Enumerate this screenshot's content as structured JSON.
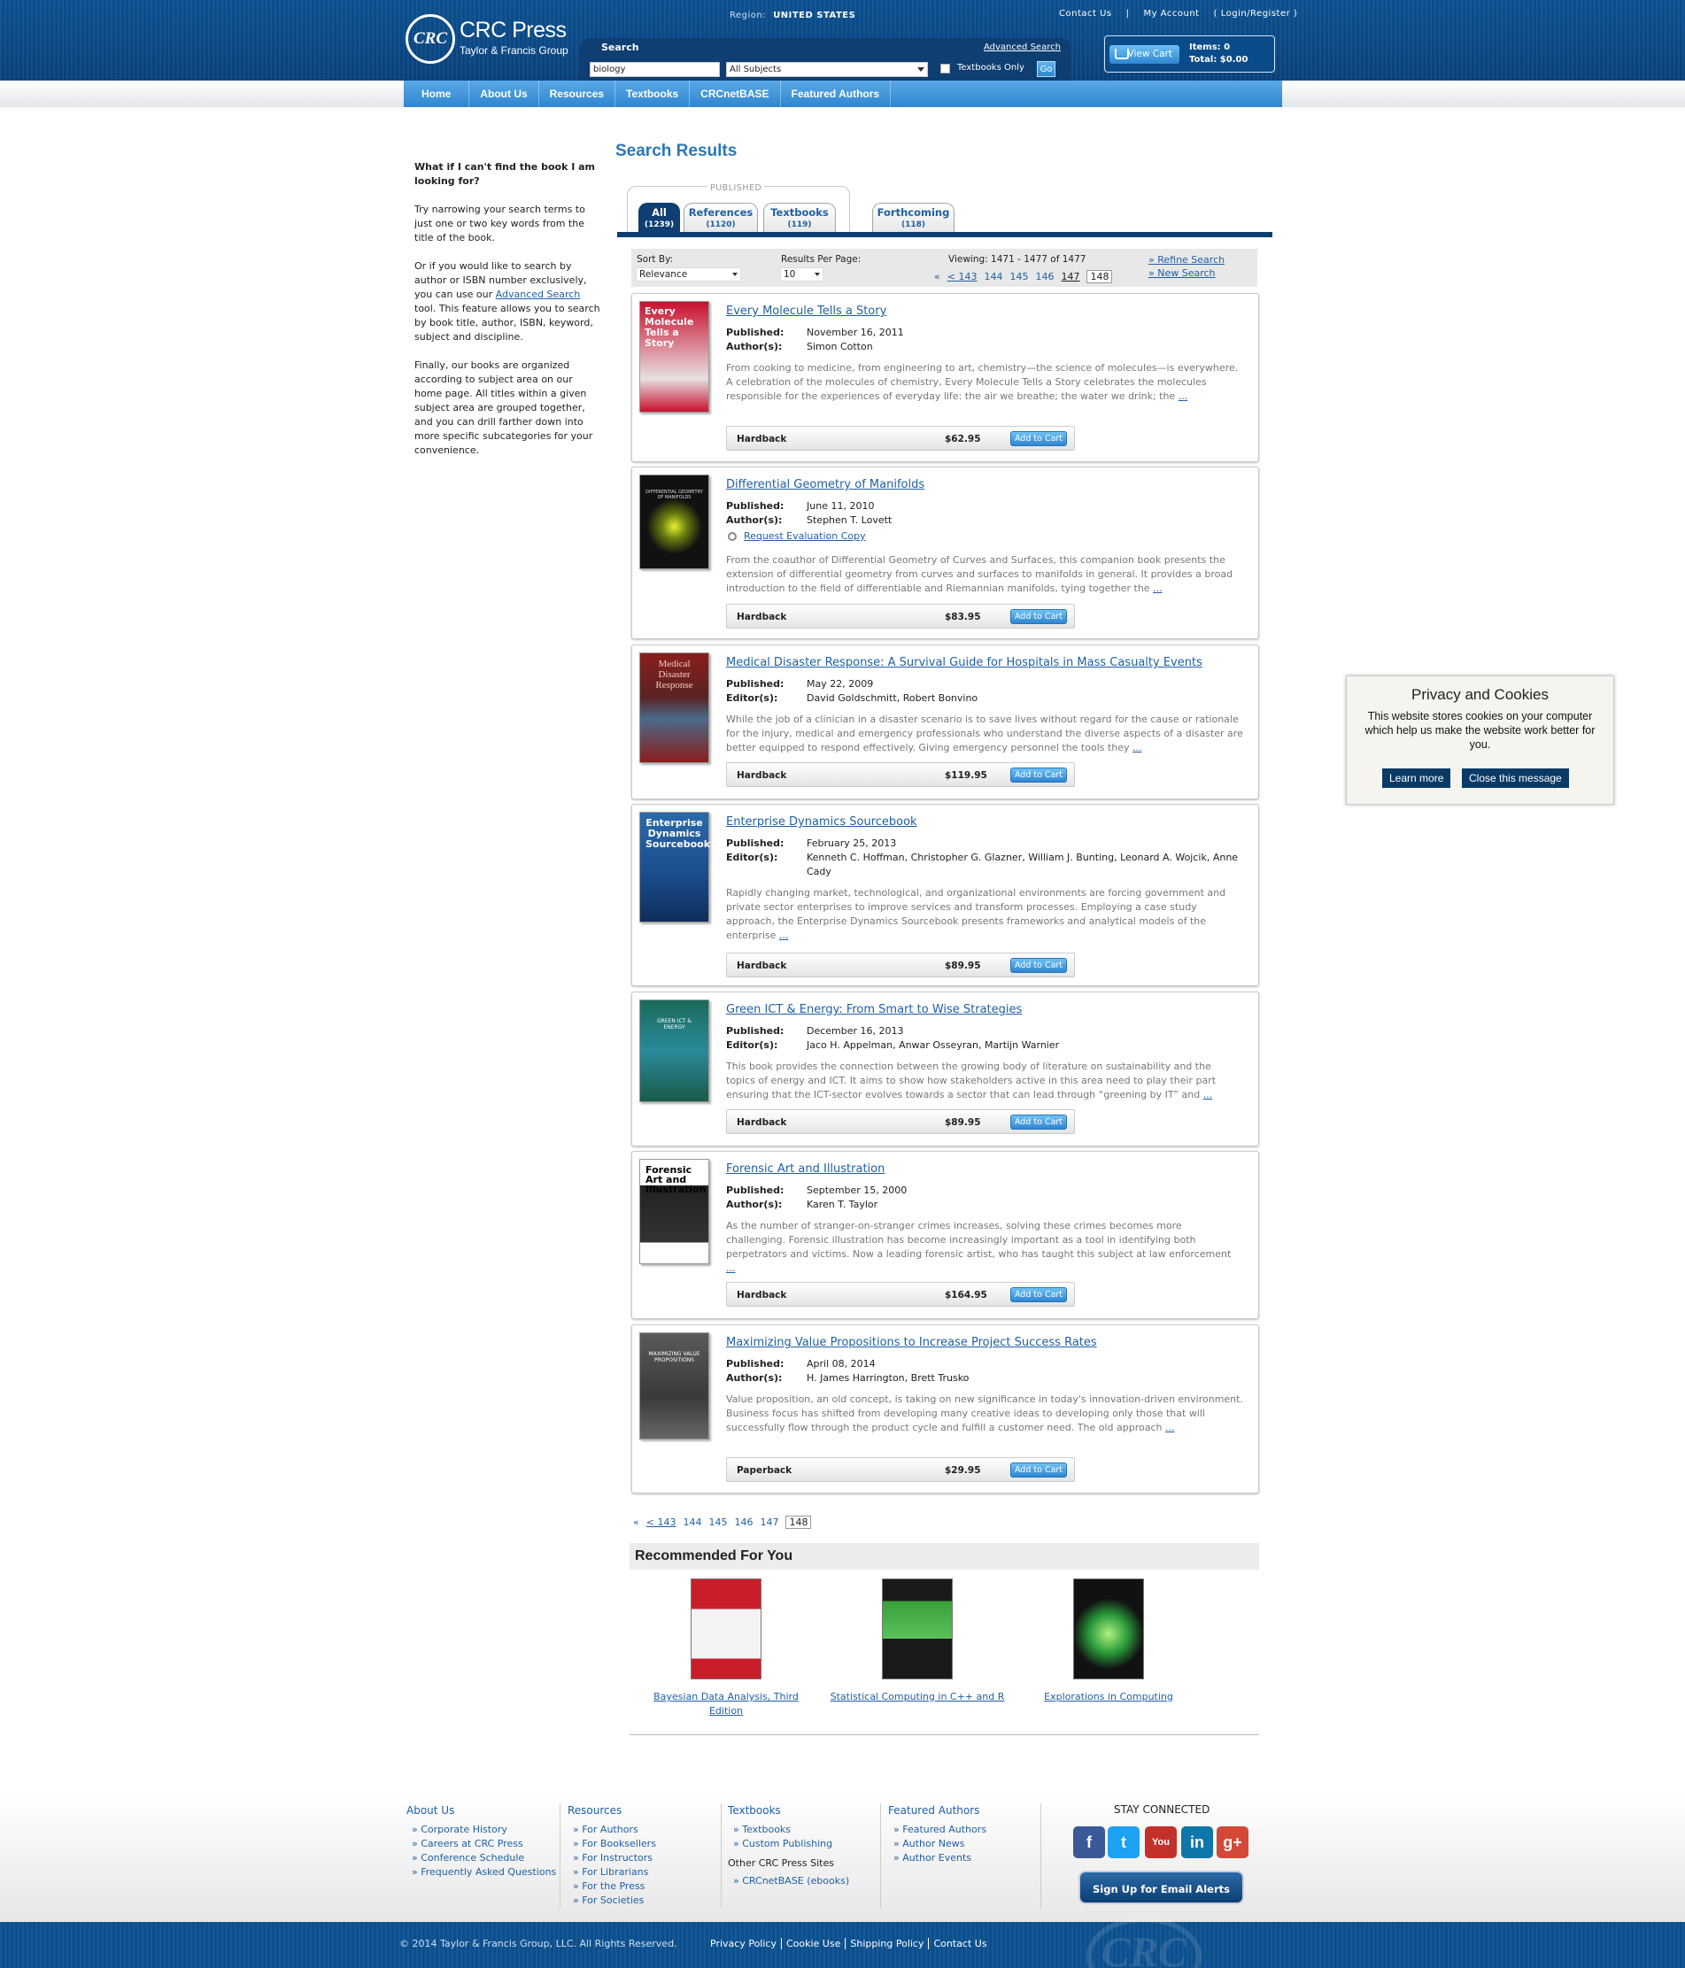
{
  "header": {
    "brand": "CRC Press",
    "brand_sub": "Taylor & Francis Group",
    "logo_text": "CRC",
    "region_label": "Region:",
    "region_value": "UNITED STATES",
    "top_links": [
      "Contact Us",
      "My Account",
      "( Login/Register )"
    ],
    "search_label": "Search",
    "advanced_search": "Advanced Search",
    "search_value": "biology",
    "subject_value": "All Subjects",
    "textbooks_only": "Textbooks Only",
    "go": "Go",
    "view_cart": "View Cart",
    "items": "Items: 0",
    "total": "Total: $0.00"
  },
  "nav": [
    "Home",
    "About Us",
    "Resources",
    "Textbooks",
    "CRCnetBASE",
    "Featured Authors"
  ],
  "help": {
    "heading": "What if I can't find the book I am looking for?",
    "p1": "Try narrowing your search terms to just one or two key words from the title of the book.",
    "p2a": "Or if you would like to search by author or ISBN number exclusively, you can use our ",
    "p2link": "Advanced Search",
    "p2b": " tool. This feature allows you to search by book title, author, ISBN, keyword, subject and discipline.",
    "p3": "Finally, our books are organized according to subject area on our home page. All titles within a given subject area are grouped together, and you can drill farther down into more specific subcategories for your convenience."
  },
  "results": {
    "title": "Search Results",
    "published_label": "PUBLISHED",
    "tabs": [
      {
        "label": "All",
        "count": "(1239)"
      },
      {
        "label": "References",
        "count": "(1120)"
      },
      {
        "label": "Textbooks",
        "count": "(119)"
      },
      {
        "label": "Forthcoming",
        "count": "(118)"
      }
    ],
    "sort_label": "Sort By:",
    "sort_value": "Relevance",
    "rpp_label": "Results Per Page:",
    "rpp_value": "10",
    "viewing": "Viewing: 1471 - 1477 of 1477",
    "pager": {
      "prev": "«",
      "first": "< 143",
      "pages": [
        "144",
        "145",
        "146"
      ],
      "p147": "147",
      "current": "148"
    },
    "refine": "» Refine Search",
    "new_search": "» New Search",
    "add_to_cart": "Add to Cart",
    "books": [
      {
        "title": "Every Molecule Tells a Story",
        "pub_label": "Published:",
        "pub": "November 16, 2011",
        "auth_label": "Author(s):",
        "auth": "Simon Cotton",
        "desc": "From cooking to medicine, from engineering to art, chemistry—the science of molecules—is everywhere. A celebration of the molecules of chemistry, Every Molecule Tells a Story celebrates the molecules responsible for the experiences of everyday life: the air we breathe; the water we drink; the ",
        "more": "...",
        "format": "Hardback",
        "price": "$62.95",
        "cover_text": "Every Molecule Tells a Story",
        "cover_bg": "#c8102e"
      },
      {
        "title": "Differential Geometry of Manifolds",
        "pub_label": "Published:",
        "pub": "June 11, 2010",
        "auth_label": "Author(s):",
        "auth": "Stephen T. Lovett",
        "eval": "Request Evaluation Copy",
        "desc": "From the coauthor of Differential Geometry of Curves and Surfaces, this companion book presents the extension of differential geometry from curves and surfaces to manifolds in general. It provides a broad introduction to the field of differentiable and Riemannian manifolds, tying together the ",
        "more": "...",
        "format": "Hardback",
        "price": "$83.95",
        "cover_text": "DIFFERENTIAL GEOMETRY OF MANIFOLDS",
        "cover_bg": "#111111"
      },
      {
        "title": "Medical Disaster Response: A Survival Guide for Hospitals in Mass Casualty Events",
        "pub_label": "Published:",
        "pub": "May 22, 2009",
        "auth_label": "Editor(s):",
        "auth": "David Goldschmitt, Robert Bonvino",
        "desc": "While the job of a clinician in a disaster scenario is to save lives without regard for the cause or rationale for the injury, medical and emergency professionals who understand the diverse aspects of a disaster are better equipped to respond effectively. Giving emergency personnel the tools they ",
        "more": "...",
        "format": "Hardback",
        "price": "$119.95",
        "cover_text": "Medical Disaster Response",
        "cover_bg": "#7a1f1f"
      },
      {
        "title": "Enterprise Dynamics Sourcebook",
        "pub_label": "Published:",
        "pub": "February 25, 2013",
        "auth_label": "Editor(s):",
        "auth": "Kenneth C. Hoffman, Christopher G. Glazner, William J. Bunting, Leonard A. Wojcik, Anne Cady",
        "desc": "Rapidly changing market, technological, and organizational environments are forcing government and private sector enterprises to improve services and transform processes. Employing a case study approach, the Enterprise Dynamics Sourcebook presents frameworks and analytical models of the enterprise ",
        "more": "...",
        "format": "Hardback",
        "price": "$89.95",
        "cover_text": "Enterprise Dynamics Sourcebook",
        "cover_bg": "#1c5a9c"
      },
      {
        "title": "Green ICT & Energy: From Smart to Wise Strategies",
        "pub_label": "Published:",
        "pub": "December 16, 2013",
        "auth_label": "Editor(s):",
        "auth": "Jaco H. Appelman, Anwar Osseyran, Martijn Warnier",
        "desc": "This book provides the connection between the growing body of literature on sustainability and the topics of energy and ICT. It aims to show how stakeholders active in this area need to play their part ensuring that the ICT-sector evolves towards a sector that can lead through “greening by IT” and ",
        "more": "...",
        "format": "Hardback",
        "price": "$89.95",
        "cover_text": "GREEN ICT & ENERGY",
        "cover_bg": "#1a7a6a"
      },
      {
        "title": "Forensic Art and Illustration",
        "pub_label": "Published:",
        "pub": "September 15, 2000",
        "auth_label": "Author(s):",
        "auth": "Karen T. Taylor",
        "desc": "As the number of stranger-on-stranger crimes increases, solving these crimes becomes more challenging. Forensic illustration has become increasingly important as a tool in identifying both perpetrators and victims. Now a leading forensic artist, who has taught this subject at law enforcement ",
        "more": "...",
        "format": "Hardback",
        "price": "$164.95",
        "cover_text": "Forensic Art and Illustration",
        "cover_bg": "#ffffff"
      },
      {
        "title": "Maximizing Value Propositions to Increase Project Success Rates",
        "pub_label": "Published:",
        "pub": "April 08, 2014",
        "auth_label": "Author(s):",
        "auth": "H. James Harrington, Brett Trusko",
        "desc": "Value proposition, an old concept, is taking on new significance in today's innovation-driven environment. Business focus has shifted from developing many creative ideas to developing only those that will successfully flow through the product cycle and fulfill a customer need. The old approach ",
        "more": "...",
        "format": "Paperback",
        "price": "$29.95",
        "cover_text": "MAXIMIZING VALUE PROPOSITIONS",
        "cover_bg": "#4a4a4a"
      }
    ]
  },
  "recommended": {
    "heading": "Recommended For You",
    "items": [
      {
        "title": "Bayesian Data Analysis, Third Edition",
        "cover_bg": "#c81e2a"
      },
      {
        "title": "Statistical Computing in C++ and R",
        "cover_bg": "#3aa03a"
      },
      {
        "title": "Explorations in Computing",
        "cover_bg": "#2a9a3a"
      }
    ]
  },
  "privacy": {
    "title": "Privacy and Cookies",
    "text": "This website stores cookies on your computer which help us make the website work better for you.",
    "learn": "Learn more",
    "close": "Close this message"
  },
  "footer": {
    "cols": [
      {
        "title": "About Us",
        "links": [
          "Corporate History",
          "Careers at CRC Press",
          "Conference Schedule",
          "Frequently Asked Questions"
        ]
      },
      {
        "title": "Resources",
        "links": [
          "For Authors",
          "For Booksellers",
          "For Instructors",
          "For Librarians",
          "For the Press",
          "For Societies"
        ]
      },
      {
        "title": "Textbooks",
        "links": [
          "Textbooks",
          "Custom Publishing"
        ],
        "other_title": "Other CRC Press Sites",
        "other_links": [
          "CRCnetBASE (ebooks)"
        ]
      },
      {
        "title": "Featured Authors",
        "links": [
          "Featured Authors",
          "Author News",
          "Author Events"
        ]
      }
    ],
    "stay": "STAY CONNECTED",
    "social": [
      {
        "name": "facebook-icon",
        "label": "f",
        "color": "#3b5998"
      },
      {
        "name": "twitter-icon",
        "label": "t",
        "color": "#1da1f2"
      },
      {
        "name": "youtube-icon",
        "label": "You",
        "color": "#c4302b"
      },
      {
        "name": "linkedin-icon",
        "label": "in",
        "color": "#0e76a8"
      },
      {
        "name": "googleplus-icon",
        "label": "g+",
        "color": "#d34836"
      }
    ],
    "email_alerts": "Sign Up for Email Alerts",
    "copyright": "© 2014 Taylor & Francis Group, LLC. All Rights Reserved.",
    "bottom_links": [
      "Privacy Policy",
      "Cookie Use",
      "Shipping Policy",
      "Contact Us"
    ]
  }
}
